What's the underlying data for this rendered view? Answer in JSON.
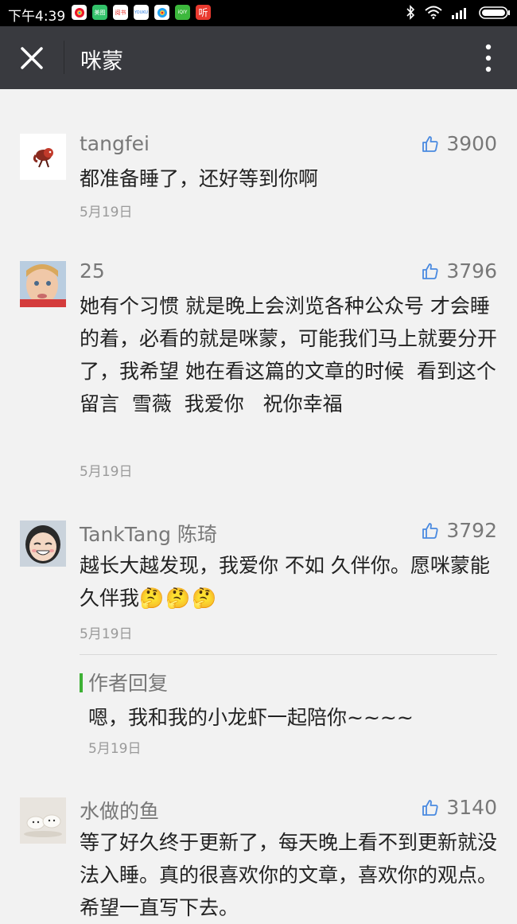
{
  "status_bar": {
    "time": "下午4:39",
    "app_icons": [
      {
        "name": "weibo-app-icon",
        "text": "",
        "color": "#ffffff"
      },
      {
        "name": "meitu-app-icon",
        "text": "美图",
        "color": "#33c26a"
      },
      {
        "name": "reader-app-icon",
        "text": "阅书",
        "color": "#ffffff"
      },
      {
        "name": "youku-app-icon",
        "text": "YOUKU",
        "color": "#ffffff"
      },
      {
        "name": "weibo-app-icon-2",
        "text": "",
        "color": "#ffffff"
      },
      {
        "name": "iqiyi-app-icon",
        "text": "iQIY",
        "color": "#3cb83c"
      },
      {
        "name": "ting-app-icon",
        "text": "听",
        "color": "#e93a2f"
      }
    ]
  },
  "navbar": {
    "title": "咪蒙"
  },
  "colors": {
    "nav_bg": "#393a3f",
    "page_bg": "#f2f2f2",
    "reply_accent": "#3eb135"
  },
  "comments": [
    {
      "name": "tangfei",
      "likes": "3900",
      "text": "都准备睡了，还好等到你啊",
      "date": "5月19日"
    },
    {
      "name": "25",
      "likes": "3796",
      "text": "她有个习惯 就是晚上会浏览各种公众号 才会睡的着，必看的就是咪蒙，可能我们马上就要分开了，我希望 她在看这篇的文章的时候  看到这个留言  雪薇  我爱你   祝你幸福",
      "date": "5月19日"
    },
    {
      "name": "TankTang 陈琦",
      "likes": "3792",
      "text": "越长大越发现，我爱你 不如 久伴你。愿咪蒙能久伴我",
      "emoji": "🤔🤔🤔",
      "date": "5月19日",
      "reply": {
        "label": "作者回复",
        "text": "嗯，我和我的小龙虾一起陪你~~~~",
        "date": "5月19日"
      }
    },
    {
      "name": "水做的鱼",
      "likes": "3140",
      "text": "等了好久终于更新了，每天晚上看不到更新就没法入睡。真的很喜欢你的文章，喜欢你的观点。希望一直写下去。",
      "date": ""
    }
  ]
}
